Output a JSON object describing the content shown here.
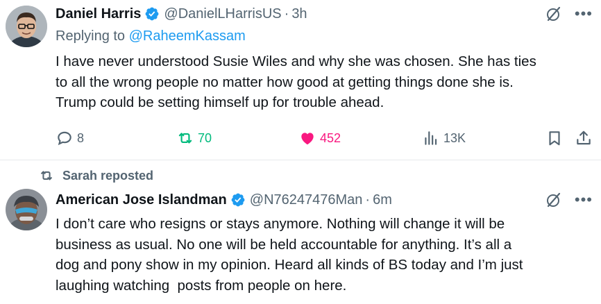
{
  "tweet1": {
    "display_name": "Daniel Harris",
    "handle": "@DanielLHarrisUS",
    "separator": "·",
    "time": "3h",
    "replying_to_prefix": "Replying to ",
    "replying_to_handle": "@RaheemKassam",
    "text_lines": [
      "I have never understood Susie Wiles and why she was chosen. She has ties",
      "to all the wrong people no matter how good at getting things done she is.",
      "Trump could be setting himself up for trouble ahead."
    ],
    "metrics": {
      "replies": "8",
      "reposts": "70",
      "likes": "452",
      "views": "13K"
    }
  },
  "repost_banner": {
    "text": "Sarah reposted"
  },
  "tweet2": {
    "display_name": "American Jose Islandman",
    "handle": "@N76247476Man",
    "separator": "·",
    "time": "6m",
    "text_lines": [
      "I don’t care who resigns or stays anymore. Nothing will change it will be",
      "business as usual. No one will be held accountable for anything. It’s all a",
      "dog and pony show in my opinion. Heard all kinds of BS today and I’m just",
      "laughing watching  posts from people on here."
    ]
  },
  "colors": {
    "verified_blue": "#1d9bf0",
    "secondary_text": "#536471",
    "repost_green": "#00ba7c",
    "like_pink": "#f91880"
  },
  "icons": [
    "verified-badge-icon",
    "grok-icon",
    "more-icon",
    "reply-icon",
    "retweet-icon",
    "heart-icon",
    "views-icon",
    "bookmark-icon",
    "share-icon"
  ]
}
